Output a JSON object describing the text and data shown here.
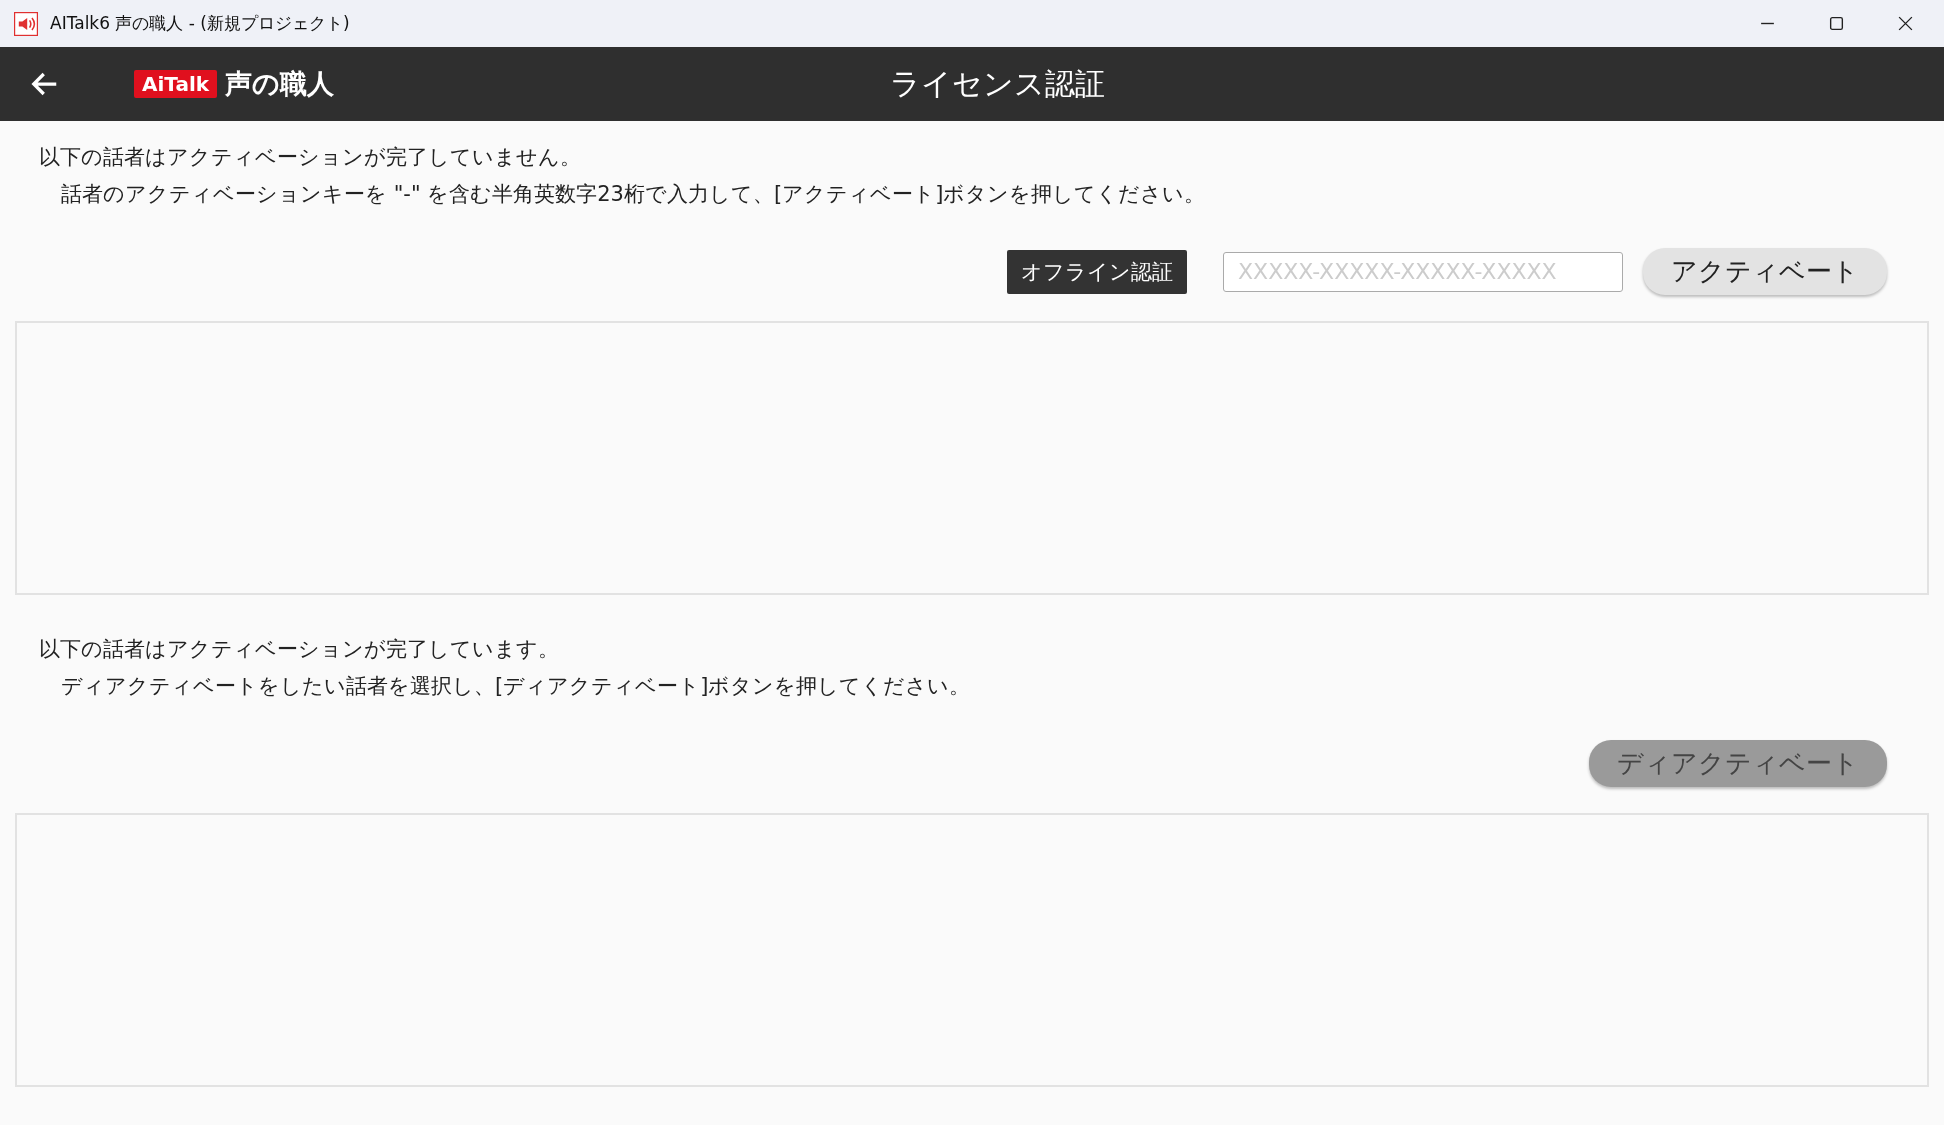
{
  "window": {
    "title": "AITalk6 声の職人 - (新規プロジェクト)"
  },
  "header": {
    "logo_badge": "AiTalk",
    "logo_text": "声の職人",
    "title": "ライセンス認証"
  },
  "sections": [
    {
      "lines": [
        "以下の話者はアクティベーションが完了していません。",
        "話者のアクティベーションキーを \"-\" を含む半角英数字23桁で入力して、[アクティベート]ボタンを押してください。"
      ],
      "controls": [
        {
          "kind": "dark",
          "label": "オフライン認証"
        },
        {
          "kind": "input",
          "placeholder": "XXXXX-XXXXX-XXXXX-XXXXX"
        },
        {
          "kind": "pill",
          "label": "アクティベート",
          "disabled": false
        }
      ]
    },
    {
      "lines": [
        "以下の話者はアクティベーションが完了しています。",
        "ディアクティベートをしたい話者を選択し、[ディアクティベート]ボタンを押してください。"
      ],
      "controls": [
        {
          "kind": "pill",
          "label": "ディアクティベート",
          "disabled": true
        }
      ]
    }
  ]
}
